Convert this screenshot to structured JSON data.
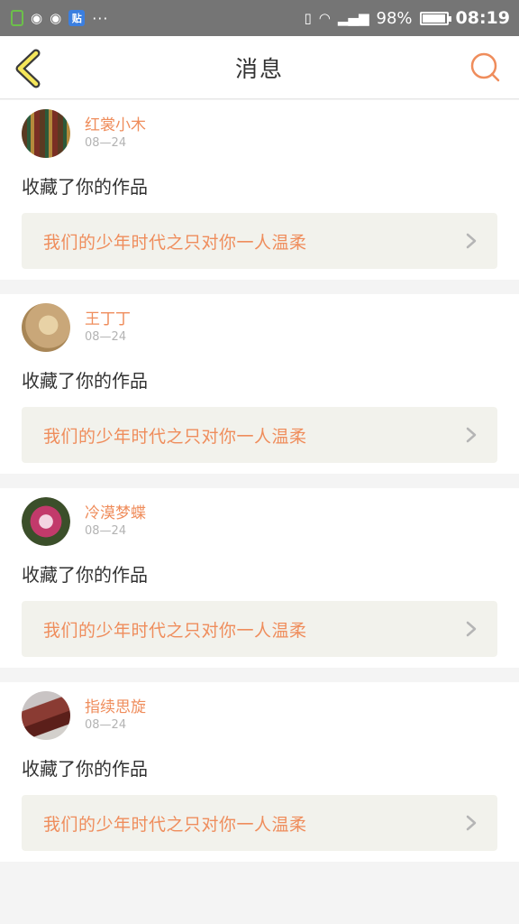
{
  "status_bar": {
    "tieba_label": "贴",
    "more": "···",
    "battery_text": "98%",
    "battery_level": 0.98,
    "time": "08:19"
  },
  "nav": {
    "title": "消息"
  },
  "messages": [
    {
      "name": "红裳小木",
      "date": "08—24",
      "action": "收藏了你的作品",
      "work_title": "我们的少年时代之只对你一人温柔"
    },
    {
      "name": "王丁丁",
      "date": "08—24",
      "action": "收藏了你的作品",
      "work_title": "我们的少年时代之只对你一人温柔"
    },
    {
      "name": "冷漠梦蝶",
      "date": "08—24",
      "action": "收藏了你的作品",
      "work_title": "我们的少年时代之只对你一人温柔"
    },
    {
      "name": "指续思旋",
      "date": "08—24",
      "action": "收藏了你的作品",
      "work_title": "我们的少年时代之只对你一人温柔"
    }
  ],
  "colors": {
    "accent": "#ef8d5c",
    "back_icon_fill": "#f5e65a",
    "status_bar": "#757575",
    "card_link_bg": "#f2f2ec"
  },
  "icons": {
    "back": "chevron-left-icon",
    "search": "search-icon",
    "link": "chevron-right-icon"
  }
}
